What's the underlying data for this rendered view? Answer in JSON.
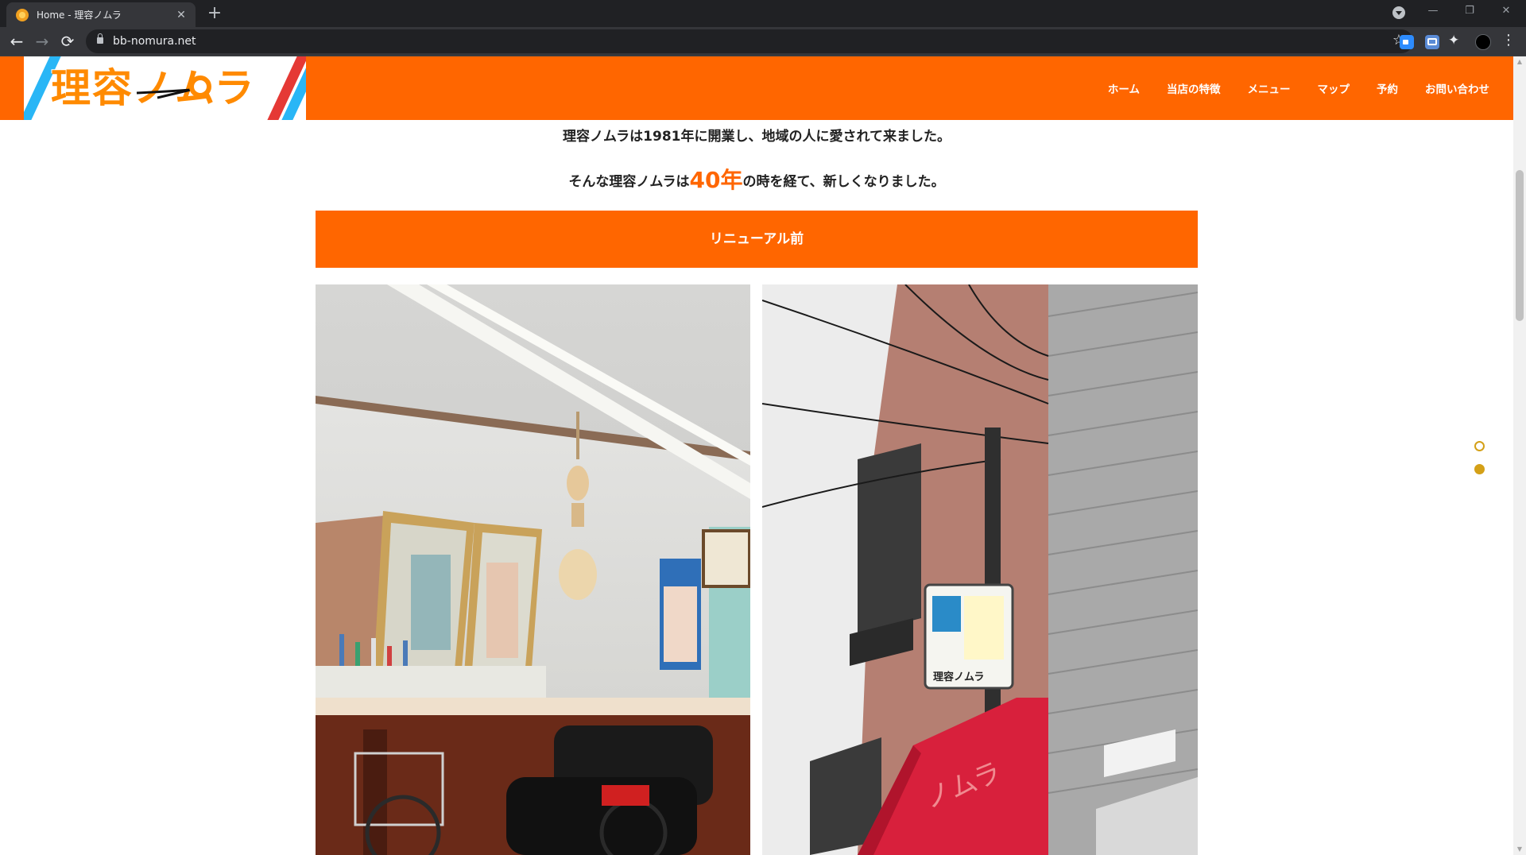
{
  "browser": {
    "tab_title": "Home - 理容ノムラ",
    "tab_close": "✕",
    "new_tab": "+",
    "url": "bb-nomura.net",
    "back": "←",
    "forward": "→",
    "reload": "⟳",
    "star": "☆",
    "extensions_icon": "✦",
    "menu": "⋮",
    "minimize": "—",
    "restore": "❐",
    "close": "✕"
  },
  "site": {
    "logo_text": "理容ノムラ",
    "nav": [
      "ホーム",
      "当店の特徴",
      "メニュー",
      "マップ",
      "予約",
      "お問い合わせ"
    ],
    "intro_line1": "理容ノムラは1981年に開業し、地域の人に愛されて来ました。",
    "intro_line2_pre": "そんな理容ノムラは",
    "intro_line2_highlight": "40年",
    "intro_line2_post": "の時を経て、新しくなりました。",
    "section_title": "リニューアル前",
    "sign_text": "理容ノムラ",
    "awning_text": "ノムラ"
  },
  "colors": {
    "brand_orange": "#ff6600",
    "dot_gold": "#d4a017"
  }
}
